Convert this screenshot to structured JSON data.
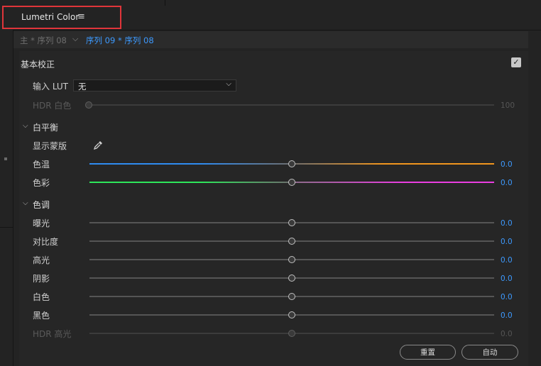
{
  "panel": {
    "title": "Lumetri Color",
    "menu_icon": "≡"
  },
  "sequence": {
    "master": "主 * 序列 08",
    "active": "序列 09 * 序列 08"
  },
  "basic": {
    "title": "基本校正",
    "enabled": true,
    "input_lut": {
      "label": "输入 LUT",
      "value": "无"
    },
    "hdr_white": {
      "label": "HDR 白色",
      "value": "100"
    }
  },
  "white_balance": {
    "title": "白平衡",
    "show_mask": "显示蒙版",
    "sliders": [
      {
        "label": "色温",
        "value": "0.0"
      },
      {
        "label": "色彩",
        "value": "0.0"
      }
    ]
  },
  "tone": {
    "title": "色调",
    "sliders": [
      {
        "label": "曝光",
        "value": "0.0"
      },
      {
        "label": "对比度",
        "value": "0.0"
      },
      {
        "label": "高光",
        "value": "0.0"
      },
      {
        "label": "阴影",
        "value": "0.0"
      },
      {
        "label": "白色",
        "value": "0.0"
      },
      {
        "label": "黑色",
        "value": "0.0"
      },
      {
        "label": "HDR 高光",
        "value": "0.0"
      }
    ]
  },
  "buttons": {
    "reset": "重置",
    "auto": "自动"
  },
  "colors": {
    "accent": "#3d9aff",
    "temp_left": "#2f8bf0",
    "temp_right": "#f0951e",
    "tint_left": "#2ee65a",
    "tint_right": "#e93ee0",
    "highlight": "#e0353a"
  }
}
